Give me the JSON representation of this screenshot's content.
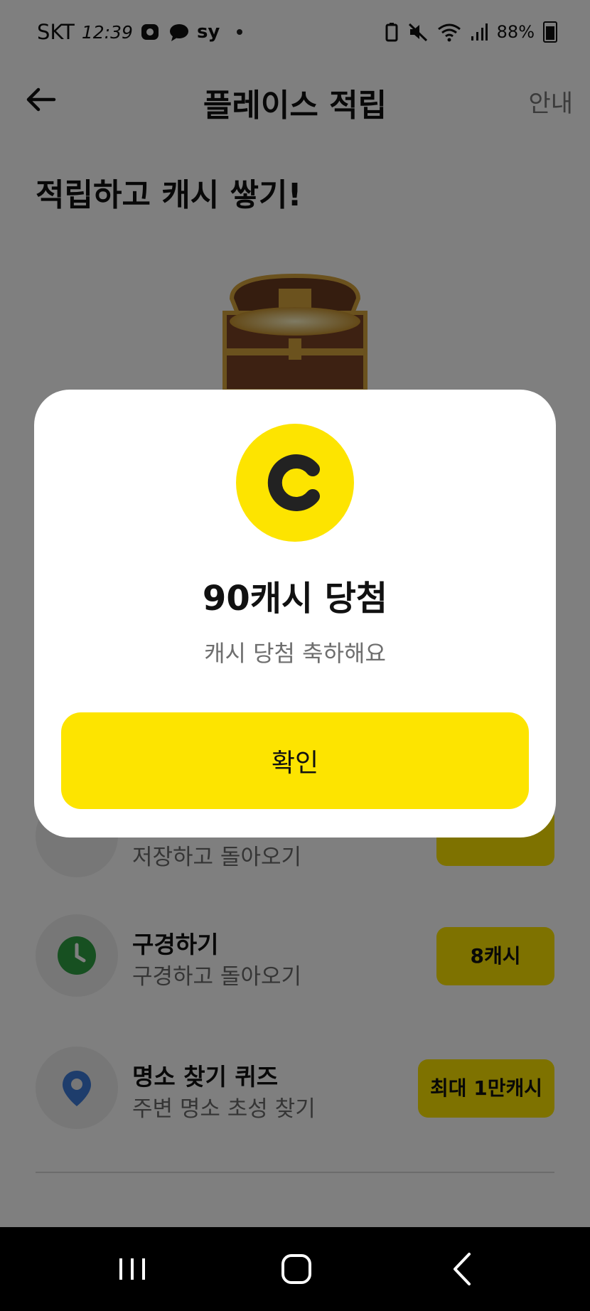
{
  "status_bar": {
    "carrier": "SKT",
    "time": "12:39",
    "app_label": "sy",
    "battery": "88%"
  },
  "header": {
    "title": "플레이스 적립",
    "info_label": "안내"
  },
  "hero": {
    "title": "적립하고 캐시 쌓기!"
  },
  "missions": [
    {
      "title": "",
      "subtitle": "저장하고 돌아오기",
      "badge": ""
    },
    {
      "title": "구경하기",
      "subtitle": "구경하고 돌아오기",
      "badge": "8캐시"
    },
    {
      "title": "명소 찾기 퀴즈",
      "subtitle": "주변 명소 초성 찾기",
      "badge": "최대 1만캐시"
    }
  ],
  "dialog": {
    "coin_letter": "C",
    "title": "90캐시 당첨",
    "subtitle": "캐시 당첨 축하해요",
    "confirm_label": "확인"
  },
  "colors": {
    "accent_yellow": "#fde400",
    "clock_green": "#2ea043",
    "pin_blue": "#3d7bd9"
  }
}
